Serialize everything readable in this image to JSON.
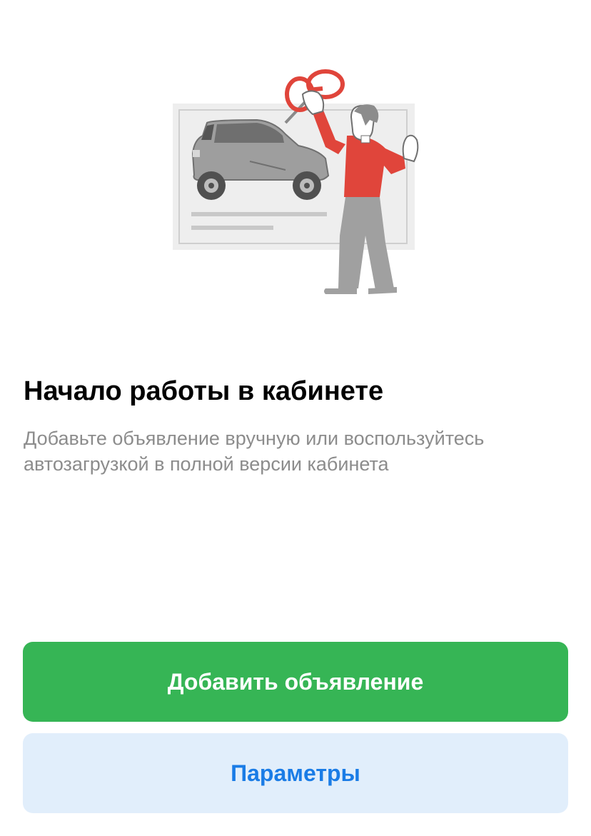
{
  "illustration": {
    "icon": "car-listing-illustration",
    "colors": {
      "board": "#eeeeee",
      "car": "#9e9e9e",
      "shirt": "#e0453b",
      "pants": "#a0a0a0",
      "pin": "#e0453b"
    }
  },
  "onboarding": {
    "title": "Начало работы в кабинете",
    "description": "Добавьте объявление вручную или воспользуйтесь автозагрузкой в полной версии кабинета"
  },
  "actions": {
    "add_listing_label": "Добавить объявление",
    "settings_label": "Параметры"
  },
  "colors": {
    "primary_button": "#36b555",
    "secondary_button": "#e1eefb",
    "secondary_text": "#1a7ce6"
  }
}
